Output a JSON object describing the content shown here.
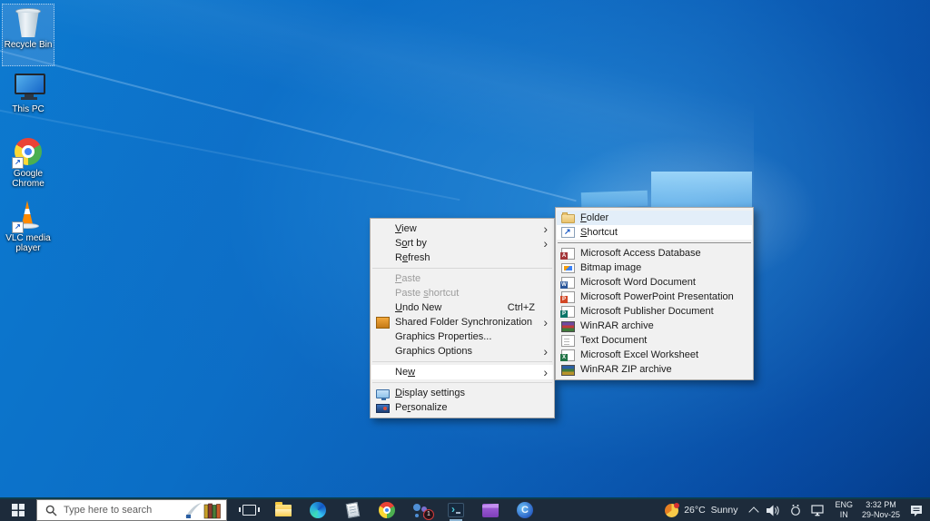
{
  "colors": {
    "wallpaper_base": "#0a6cc4",
    "taskbar": "#1d2b3b",
    "menu_background": "#f1f1f1",
    "menu_highlight": "#ffffff",
    "selection_highlight": "#60a0dc"
  },
  "desktop": {
    "icons": [
      {
        "label": "Recycle Bin",
        "icon": "recycle-bin-icon",
        "selected": true
      },
      {
        "label": "This PC",
        "icon": "this-pc-icon"
      },
      {
        "label": "Google Chrome",
        "icon": "chrome-icon",
        "shortcut": true
      },
      {
        "label": "VLC media player",
        "icon": "vlc-icon",
        "shortcut": true
      }
    ]
  },
  "context_menu": {
    "items": [
      {
        "label": "View",
        "u": 0,
        "submenu": true
      },
      {
        "label": "Sort by",
        "u": 1,
        "submenu": true
      },
      {
        "label": "Refresh",
        "u": 1
      },
      {
        "type": "separator"
      },
      {
        "label": "Paste",
        "u": 0,
        "disabled": true
      },
      {
        "label": "Paste shortcut",
        "u": 6,
        "disabled": true
      },
      {
        "label": "Undo New",
        "u": 0,
        "shortcut_key": "Ctrl+Z"
      },
      {
        "label": "Shared Folder Synchronization",
        "icon": "shared-folder-sync-icon",
        "submenu": true
      },
      {
        "label": "Graphics Properties..."
      },
      {
        "label": "Graphics Options",
        "submenu": true
      },
      {
        "type": "separator"
      },
      {
        "label": "New",
        "u": 2,
        "submenu": true,
        "highlighted": true
      },
      {
        "type": "separator"
      },
      {
        "label": "Display settings",
        "u": 0,
        "icon": "display-settings-icon"
      },
      {
        "label": "Personalize",
        "u": 2,
        "icon": "personalize-icon"
      }
    ]
  },
  "new_submenu": {
    "items": [
      {
        "label": "Folder",
        "u": 0,
        "icon": "folder-icon",
        "hovered": true
      },
      {
        "label": "Shortcut",
        "u": 0,
        "icon": "shortcut-icon",
        "highlighted": true
      },
      {
        "type": "separator",
        "strong": true
      },
      {
        "label": "Microsoft Access Database",
        "icon": "access-icon page"
      },
      {
        "label": "Bitmap image",
        "icon": "bitmap-icon"
      },
      {
        "label": "Microsoft Word Document",
        "icon": "word-icon page"
      },
      {
        "label": "Microsoft PowerPoint Presentation",
        "icon": "powerpoint-icon page"
      },
      {
        "label": "Microsoft Publisher Document",
        "icon": "publisher-icon page"
      },
      {
        "label": "WinRAR archive",
        "icon": "winrar-icon"
      },
      {
        "label": "Text Document",
        "icon": "text-doc-icon"
      },
      {
        "label": "Microsoft Excel Worksheet",
        "icon": "excel-icon page"
      },
      {
        "label": "WinRAR ZIP archive",
        "icon": "winrar-zip-icon"
      }
    ]
  },
  "taskbar": {
    "search": {
      "placeholder": "Type here to search"
    },
    "apps": [
      {
        "name": "task-view",
        "icon": "task-view-icon"
      },
      {
        "name": "file-explorer",
        "icon": "file-explorer-icon"
      },
      {
        "name": "edge",
        "icon": "edge-icon"
      },
      {
        "name": "notepad",
        "icon": "notepad-icon"
      },
      {
        "name": "chrome",
        "icon": "chrome-icon"
      },
      {
        "name": "people",
        "icon": "people-icon",
        "badge": "1"
      },
      {
        "name": "terminal",
        "icon": "terminal-icon",
        "running": true
      },
      {
        "name": "video-editor",
        "icon": "clapperboard-icon"
      },
      {
        "name": "c-app",
        "icon": "c-app-icon"
      }
    ],
    "tray": {
      "weather_temp": "26°C",
      "weather_cond": "Sunny",
      "lang_line1": "ENG",
      "lang_line2": "IN",
      "time": "3:32 PM",
      "date": "29-Nov-25"
    }
  }
}
